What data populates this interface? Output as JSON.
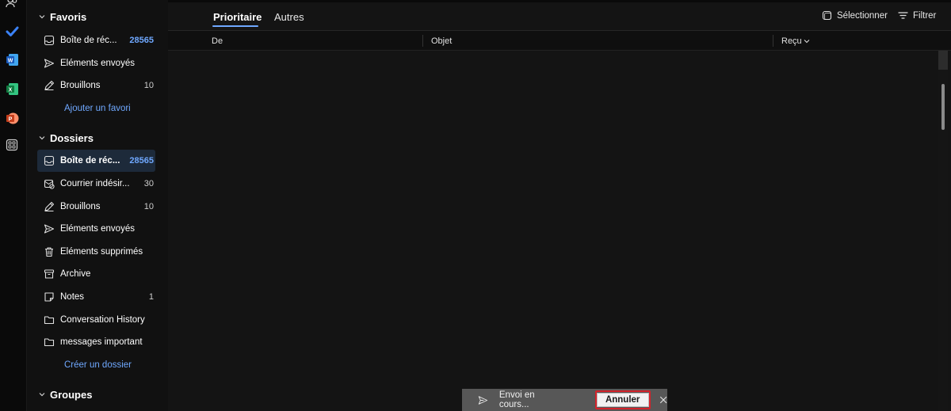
{
  "rail": {
    "icons": [
      "people-icon",
      "todo-icon",
      "word-icon",
      "excel-icon",
      "powerpoint-icon",
      "apps-icon"
    ],
    "word_letter": "W",
    "excel_letter": "X",
    "powerpoint_letter": "P"
  },
  "favorites": {
    "title": "Favoris",
    "items": [
      {
        "label": "Boîte de réc...",
        "count": "28565",
        "icon": "inbox-icon"
      },
      {
        "label": "Éléments envoyés",
        "count": "",
        "icon": "send-icon"
      },
      {
        "label": "Brouillons",
        "count": "10",
        "icon": "draft-icon"
      }
    ],
    "add_link": "Ajouter un favori"
  },
  "folders": {
    "title": "Dossiers",
    "items": [
      {
        "label": "Boîte de réc...",
        "count": "28565",
        "icon": "inbox-icon"
      },
      {
        "label": "Courrier indésir...",
        "count": "30",
        "icon": "junk-icon"
      },
      {
        "label": "Brouillons",
        "count": "10",
        "icon": "draft-icon"
      },
      {
        "label": "Éléments envoyés",
        "count": "",
        "icon": "send-icon"
      },
      {
        "label": "Éléments supprimés",
        "count": "",
        "icon": "trash-icon"
      },
      {
        "label": "Archive",
        "count": "",
        "icon": "archive-icon"
      },
      {
        "label": "Notes",
        "count": "1",
        "icon": "note-icon"
      },
      {
        "label": "Conversation History",
        "count": "",
        "icon": "folder-icon"
      },
      {
        "label": "messages important",
        "count": "",
        "icon": "folder-icon"
      }
    ],
    "create_link": "Créer un dossier"
  },
  "groups": {
    "title": "Groupes"
  },
  "main": {
    "tabs": [
      {
        "label": "Prioritaire",
        "active": true
      },
      {
        "label": "Autres",
        "active": false
      }
    ],
    "select_label": "Sélectionner",
    "filter_label": "Filtrer",
    "columns": {
      "from": "De",
      "subject": "Objet",
      "received": "Reçu"
    }
  },
  "toast": {
    "message": "Envoi en cours...",
    "cancel_label": "Annuler"
  },
  "colors": {
    "accent": "#6fa8ff",
    "highlight": "#d4232b",
    "selected_bg": "#1d2a3a"
  }
}
